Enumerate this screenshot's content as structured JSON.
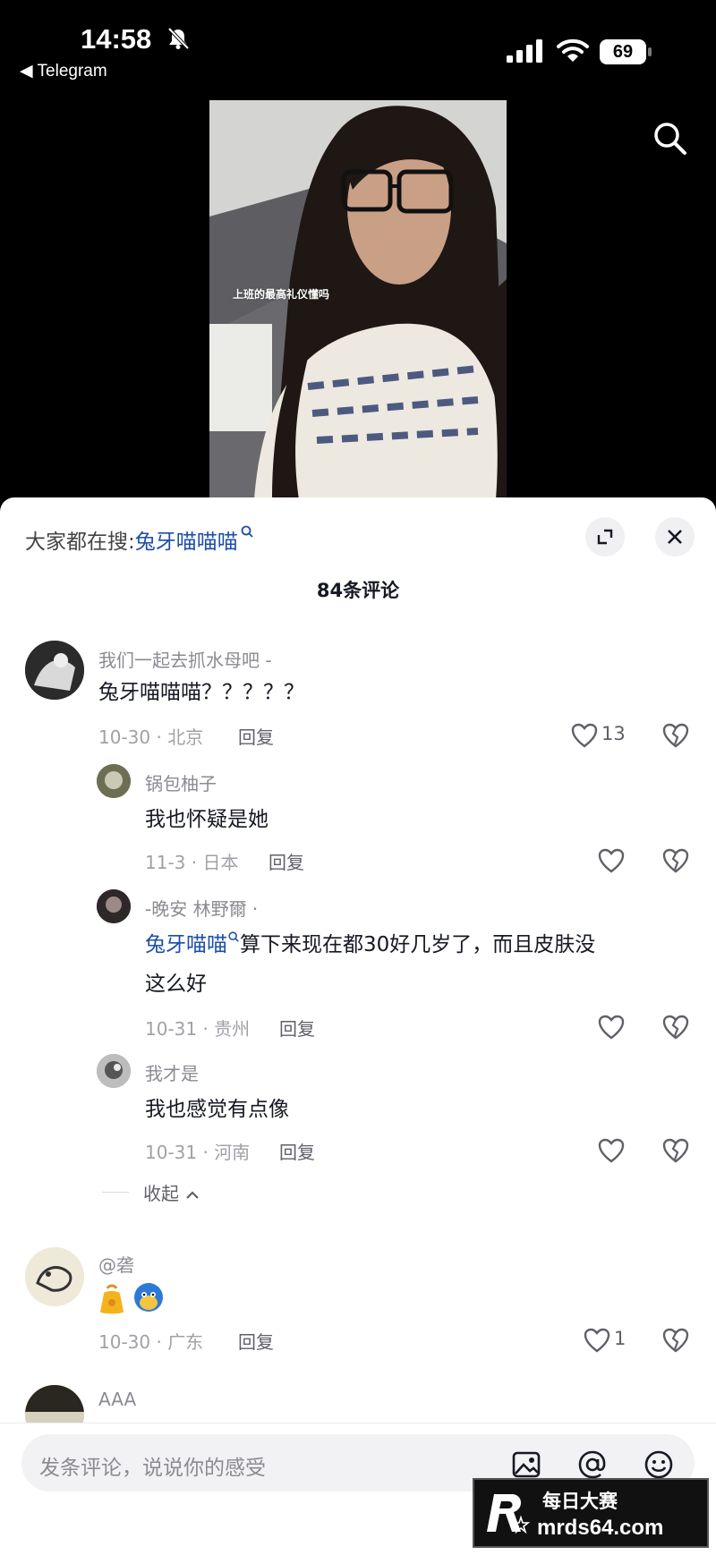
{
  "status_bar": {
    "time": "14:58",
    "back_app": "◀ Telegram",
    "battery": "69"
  },
  "video": {
    "caption": "上班的最高礼仪懂吗"
  },
  "sheet": {
    "hot_search_prefix": "大家都在搜:",
    "hot_search_keyword": "兔牙喵喵喵",
    "comment_count": "84条评论",
    "collapse_label": "收起"
  },
  "comments": [
    {
      "user": "我们一起去抓水母吧 -",
      "text": "兔牙喵喵喵？？？？？",
      "date_loc": "10-30 · 北京",
      "reply": "回复",
      "likes": "13"
    },
    {
      "user": "锅包柚子",
      "text": "我也怀疑是她",
      "date_loc": "11-3 · 日本",
      "reply": "回复"
    },
    {
      "user": "-晚安 林野爾 ·",
      "mention": "兔牙喵喵",
      "text": "算下来现在都30好几岁了，而且皮肤没",
      "text2": "这么好",
      "date_loc": "10-31 · 贵州",
      "reply": "回复"
    },
    {
      "user": "我才是",
      "text": "我也感觉有点像",
      "date_loc": "10-31 · 河南",
      "reply": "回复"
    },
    {
      "user": "@砻",
      "text": "",
      "date_loc": "10-30 · 广东",
      "reply": "回复",
      "likes": "1"
    },
    {
      "user": "AAA"
    }
  ],
  "input": {
    "placeholder": "发条评论，说说你的感受"
  },
  "watermark": {
    "line1": "每日大赛",
    "line2": "mrds64.com"
  }
}
